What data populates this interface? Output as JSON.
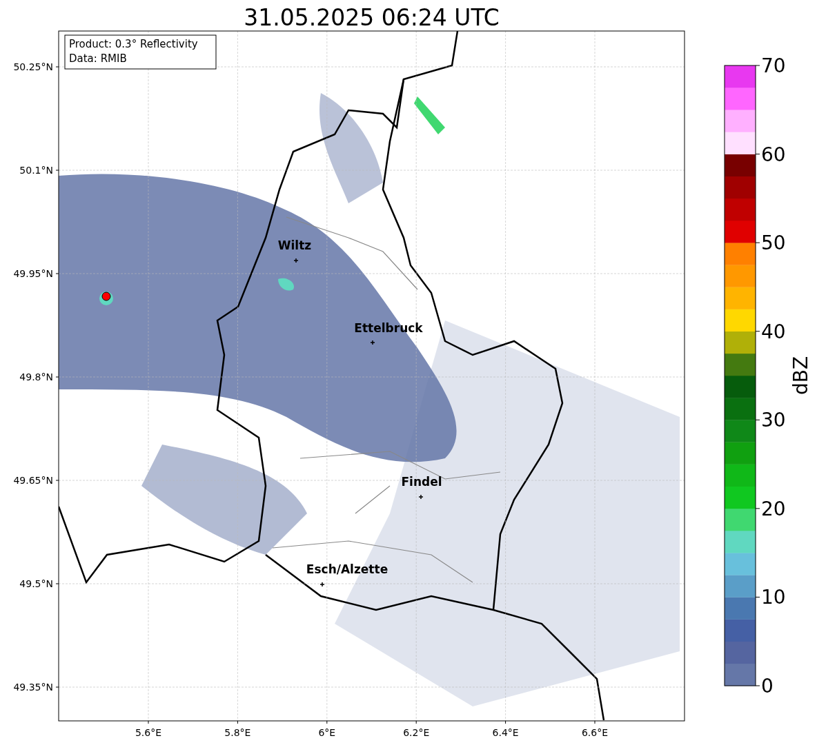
{
  "title": "31.05.2025 06:24 UTC",
  "info_box": {
    "lines": [
      "Product: 0.3° Reflectivity",
      "Data: RMIB"
    ]
  },
  "map": {
    "lat_ticks": [
      "50.25°N",
      "50.1°N",
      "49.95°N",
      "49.8°N",
      "49.65°N",
      "49.5°N",
      "49.35°N"
    ],
    "lon_ticks": [
      "5.6°E",
      "5.8°E",
      "6°E",
      "6.2°E",
      "6.4°E",
      "6.6°E"
    ],
    "cities": [
      {
        "name": "Wiltz",
        "kind": "city"
      },
      {
        "name": "Ettelbruck",
        "kind": "city"
      },
      {
        "name": "Findel",
        "kind": "city"
      },
      {
        "name": "Esch/Alzette",
        "kind": "city"
      },
      {
        "kind": "radar"
      }
    ]
  },
  "colorbar": {
    "label": "dBZ",
    "ticks": [
      "70",
      "60",
      "50",
      "40",
      "30",
      "20",
      "10",
      "0"
    ],
    "bins": [
      {
        "color": "#6577a8"
      },
      {
        "color": "#5565a0"
      },
      {
        "color": "#4560a5"
      },
      {
        "color": "#4a78b0"
      },
      {
        "color": "#5a9ec8"
      },
      {
        "color": "#68c0dc"
      },
      {
        "color": "#60d8c0"
      },
      {
        "color": "#40d870"
      },
      {
        "color": "#10c820"
      },
      {
        "color": "#10b818"
      },
      {
        "color": "#10a010"
      },
      {
        "color": "#0f8818"
      },
      {
        "color": "#0a7010"
      },
      {
        "color": "#065c0c"
      },
      {
        "color": "#447a10"
      },
      {
        "color": "#b0b008"
      },
      {
        "color": "#ffd800"
      },
      {
        "color": "#ffb400"
      },
      {
        "color": "#ff9800"
      },
      {
        "color": "#ff8000"
      },
      {
        "color": "#e00000"
      },
      {
        "color": "#c00000"
      },
      {
        "color": "#a00000"
      },
      {
        "color": "#780000"
      },
      {
        "color": "#ffe0ff"
      },
      {
        "color": "#ffb0ff"
      },
      {
        "color": "#ff66ff"
      },
      {
        "color": "#e838f0"
      }
    ]
  }
}
